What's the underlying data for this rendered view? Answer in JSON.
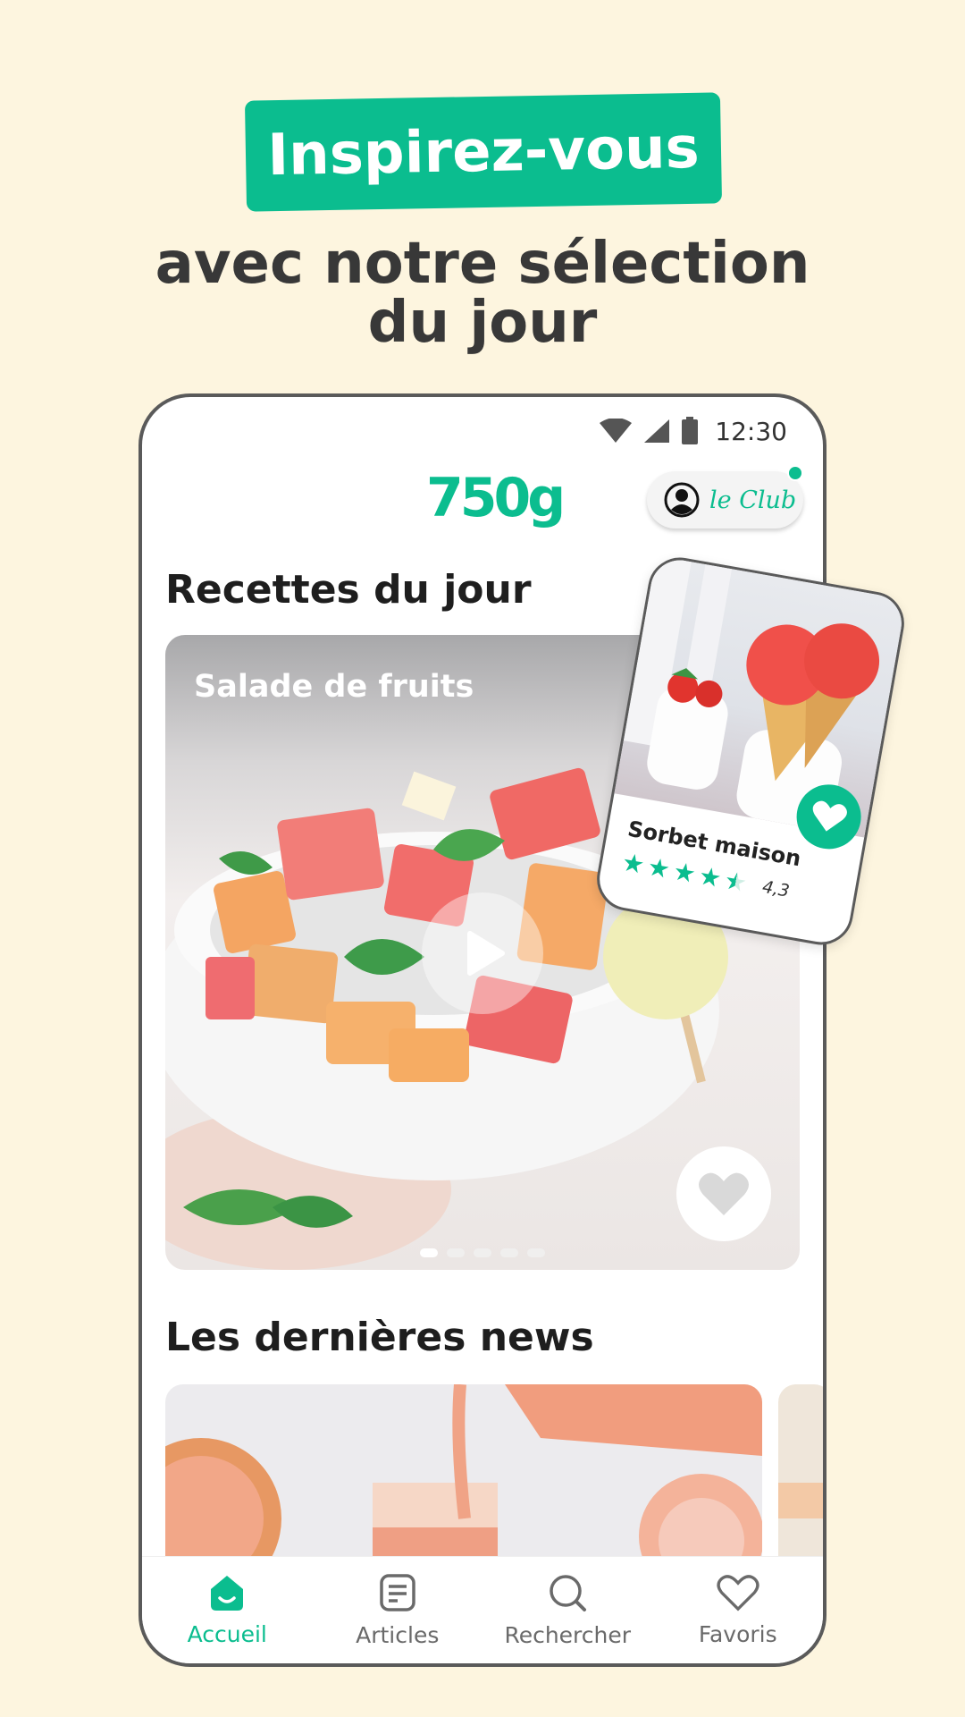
{
  "promo": {
    "badge": "Inspirez-vous",
    "subtitle_line1": "avec notre sélection",
    "subtitle_line2": "du jour"
  },
  "status_bar": {
    "time": "12:30",
    "icons": [
      "wifi-icon",
      "signal-icon",
      "battery-icon"
    ]
  },
  "header": {
    "logo": "750g",
    "club_label": "le Club"
  },
  "sections": {
    "daily_title": "Recettes du jour",
    "news_title": "Les dernières news"
  },
  "hero": {
    "title": "Salade de fruits",
    "carousel_count": 5,
    "carousel_active_index": 0
  },
  "featured": {
    "title": "Sorbet maison",
    "rating": "4,3",
    "rating_value": 4.3,
    "max_stars": 5
  },
  "bottom_nav": {
    "items": [
      {
        "label": "Accueil",
        "icon": "home-icon",
        "active": true
      },
      {
        "label": "Articles",
        "icon": "articles-icon",
        "active": false
      },
      {
        "label": "Rechercher",
        "icon": "search-icon",
        "active": false
      },
      {
        "label": "Favoris",
        "icon": "heart-icon",
        "active": false
      }
    ]
  },
  "colors": {
    "accent": "#0bbd8f",
    "background": "#fdf5df",
    "text_dark": "#383838"
  }
}
